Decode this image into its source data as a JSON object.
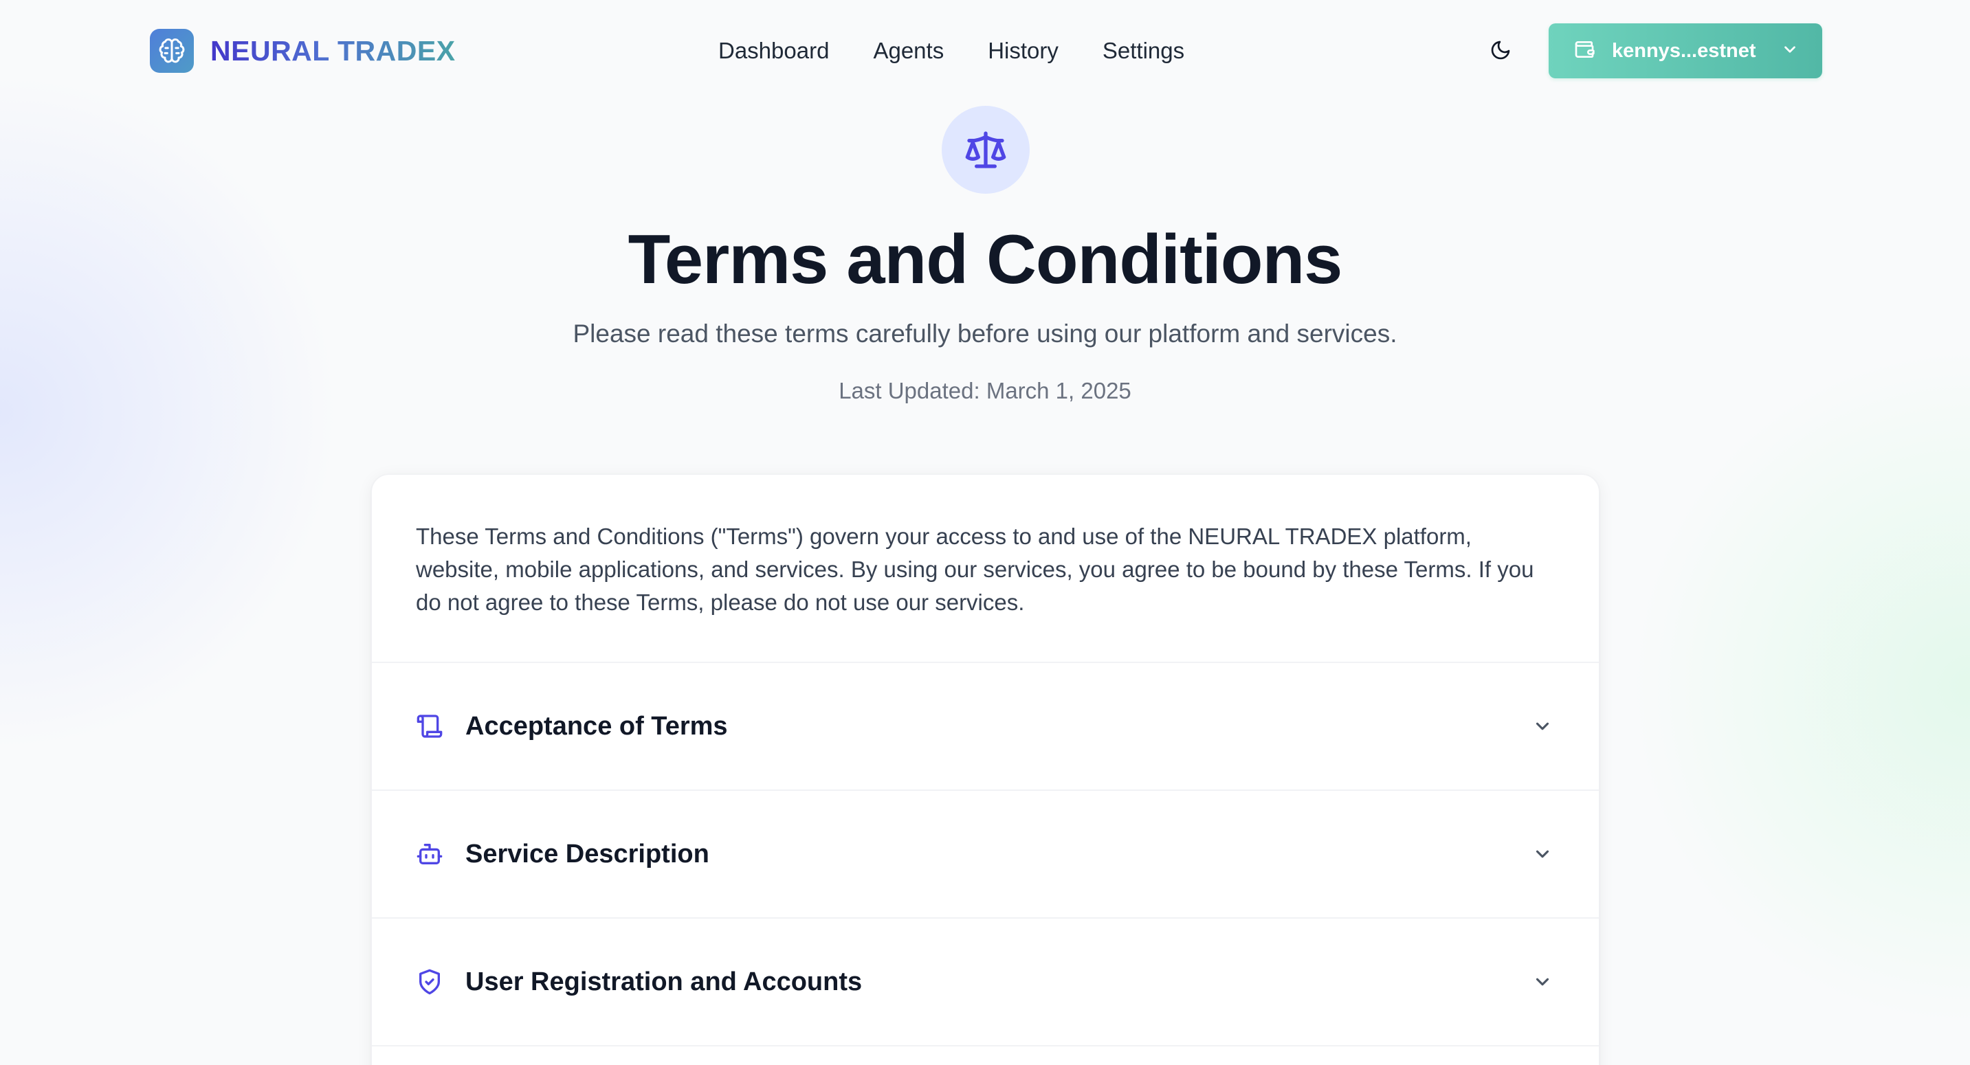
{
  "header": {
    "brand_name": "NEURAL TRADEX",
    "logo_icon": "brain-icon",
    "nav": [
      {
        "label": "Dashboard"
      },
      {
        "label": "Agents"
      },
      {
        "label": "History"
      },
      {
        "label": "Settings"
      }
    ],
    "theme_toggle_icon": "moon-icon",
    "wallet": {
      "icon": "wallet-icon",
      "label": "kennys...estnet",
      "dropdown_icon": "chevron-down-icon"
    }
  },
  "hero": {
    "icon": "scale-icon",
    "title": "Terms and Conditions",
    "subtitle": "Please read these terms carefully before using our platform and services.",
    "last_updated": "Last Updated: March 1, 2025"
  },
  "card": {
    "intro": "These Terms and Conditions (\"Terms\") govern your access to and use of the NEURAL TRADEX platform, website, mobile applications, and services. By using our services, you agree to be bound by these Terms. If you do not agree to these Terms, please do not use our services.",
    "sections": [
      {
        "title": "Acceptance of Terms",
        "icon": "scroll-icon"
      },
      {
        "title": "Service Description",
        "icon": "robot-icon"
      },
      {
        "title": "User Registration and Accounts",
        "icon": "shield-check-icon"
      }
    ]
  },
  "colors": {
    "accent": "#4f46e5",
    "brand_gradient_start": "#4338ca",
    "brand_gradient_end": "#4aa3a8",
    "wallet_button": "#5cc4b0",
    "icon_circle_bg": "#e0e7ff"
  }
}
